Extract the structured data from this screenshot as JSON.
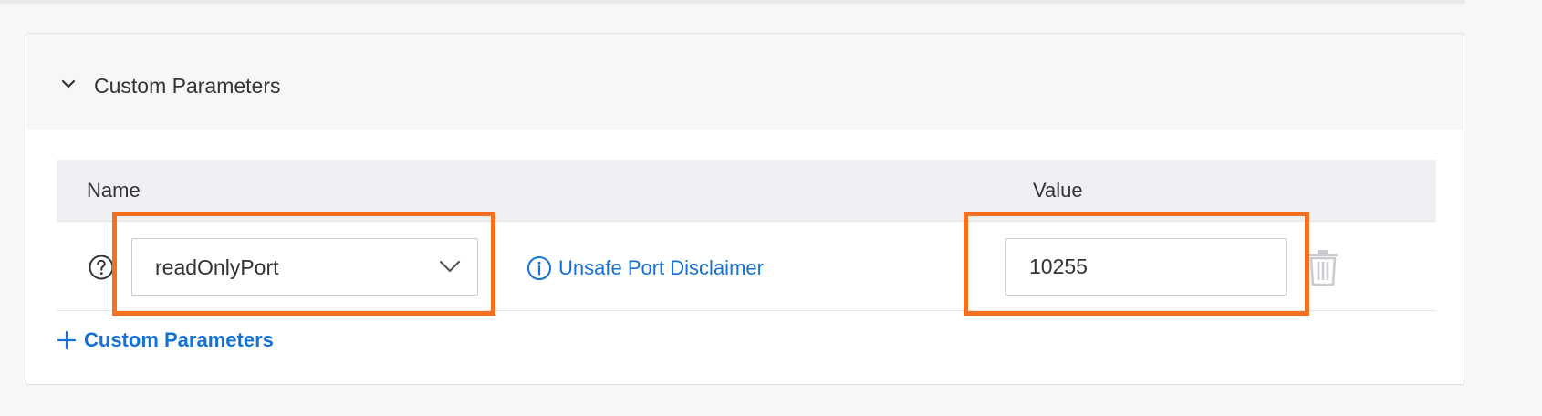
{
  "section": {
    "title": "Custom Parameters",
    "expanded": true
  },
  "table": {
    "columns": {
      "name": "Name",
      "value": "Value"
    },
    "rows": [
      {
        "name": "readOnlyPort",
        "disclaimer": "Unsafe Port Disclaimer",
        "value": "10255"
      }
    ]
  },
  "add_button": {
    "label": "Custom Parameters"
  },
  "colors": {
    "link": "#1471d6",
    "highlight": "#f37021",
    "header_bg": "#f6f7f9",
    "table_header_bg": "#eef0f4"
  },
  "icons": {
    "collapse": "chevron-down-icon",
    "help": "question-circle-icon",
    "dropdown": "chevron-down-icon",
    "info": "info-circle-icon",
    "delete": "trash-icon",
    "add": "plus-icon"
  }
}
